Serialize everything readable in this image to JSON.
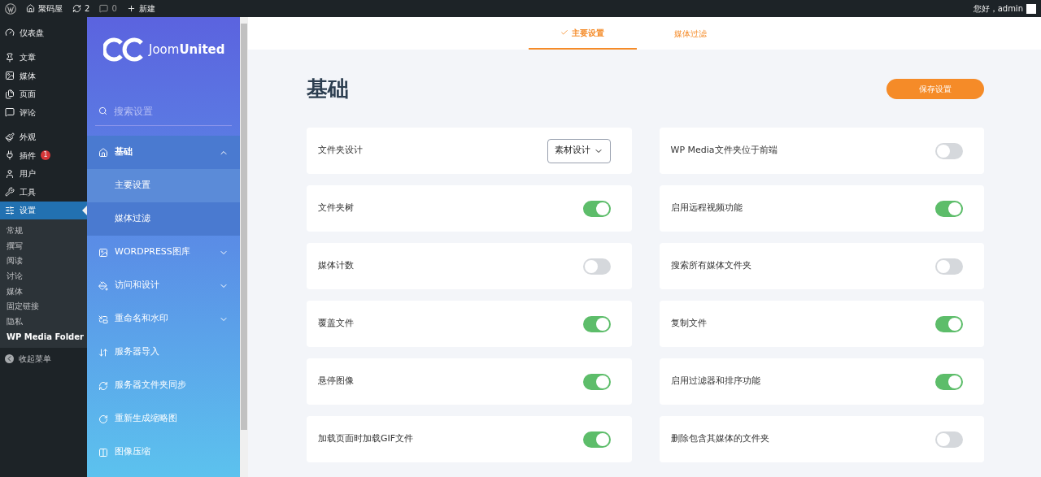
{
  "admin_bar": {
    "site": "聚码屋",
    "updates": "2",
    "comments": "0",
    "new": "新建",
    "greeting": "您好，admin"
  },
  "wp_menu": {
    "groups": [
      [
        {
          "label": "仪表盘"
        }
      ],
      [
        {
          "label": "文章"
        },
        {
          "label": "媒体"
        },
        {
          "label": "页面"
        },
        {
          "label": "评论"
        }
      ],
      [
        {
          "label": "外观"
        },
        {
          "label": "插件",
          "badge": "1"
        },
        {
          "label": "用户"
        },
        {
          "label": "工具"
        },
        {
          "label": "设置",
          "selected": true
        }
      ]
    ],
    "submenu": [
      {
        "label": "常规",
        "selected": false
      },
      {
        "label": "撰写",
        "selected": false
      },
      {
        "label": "阅读",
        "selected": false
      },
      {
        "label": "讨论",
        "selected": false
      },
      {
        "label": "媒体",
        "selected": false
      },
      {
        "label": "固定链接",
        "selected": false
      },
      {
        "label": "隐私",
        "selected": false
      },
      {
        "label": "WP Media Folder",
        "selected": true
      }
    ],
    "collapse": "收起菜单"
  },
  "plugin_sidebar": {
    "logo": "Joom**United**",
    "search": {
      "placeholder": "搜索设置"
    },
    "items": [
      {
        "label": "基础",
        "expanded": true,
        "selected": true,
        "children": [
          {
            "label": "主要设置",
            "selected": true
          },
          {
            "label": "媒体过滤",
            "selected": false
          }
        ]
      },
      {
        "label": "WORDPRESS图库",
        "expanded": false,
        "selected": false
      },
      {
        "label": "访问和设计",
        "expanded": false,
        "selected": false
      },
      {
        "label": "重命名和水印",
        "expanded": false,
        "selected": false
      },
      {
        "label": "服务器导入",
        "selected": false
      },
      {
        "label": "服务器文件夹同步",
        "selected": false
      },
      {
        "label": "重新生成缩略图",
        "selected": false
      },
      {
        "label": "图像压缩",
        "selected": false
      }
    ]
  },
  "tabs": [
    {
      "label": "主要设置",
      "selected": true
    },
    {
      "label": "媒体过滤",
      "selected": false
    }
  ],
  "title": "基础",
  "save_button": "保存设置",
  "settings": [
    {
      "label": "文件夹设计",
      "kind": "select",
      "value": "素材设计"
    },
    {
      "label": "WP Media文件夹位于前端",
      "kind": "toggle",
      "on": false
    },
    {
      "label": "文件夹树",
      "kind": "toggle",
      "on": true
    },
    {
      "label": "启用远程视频功能",
      "kind": "toggle",
      "on": true
    },
    {
      "label": "媒体计数",
      "kind": "toggle",
      "on": false
    },
    {
      "label": "搜索所有媒体文件夹",
      "kind": "toggle",
      "on": false
    },
    {
      "label": "覆盖文件",
      "kind": "toggle",
      "on": true
    },
    {
      "label": "复制文件",
      "kind": "toggle",
      "on": true
    },
    {
      "label": "悬停图像",
      "kind": "toggle",
      "on": true
    },
    {
      "label": "启用过滤器和排序功能",
      "kind": "toggle",
      "on": true
    },
    {
      "label": "加载页面时加载GIF文件",
      "kind": "toggle",
      "on": true
    },
    {
      "label": "删除包含其媒体的文件夹",
      "kind": "toggle",
      "on": false
    }
  ]
}
